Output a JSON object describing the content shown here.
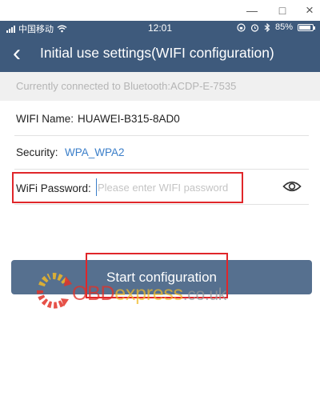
{
  "window": {
    "minimize_glyph": "—",
    "maximize_glyph": "□",
    "close_glyph": "×"
  },
  "status_bar": {
    "carrier": "中国移动",
    "time": "12:01",
    "battery_text": "85%",
    "battery_level": 0.85,
    "icons": [
      "signal-icon",
      "wifi-icon",
      "lock-rotation-icon",
      "alarm-icon",
      "bluetooth-icon",
      "battery-icon"
    ]
  },
  "nav": {
    "back_glyph": "‹",
    "title": "Initial use settings(WIFI configuration)"
  },
  "info": {
    "connected_text": "Currently connected to Bluetooth:ACDP-E-7535"
  },
  "form": {
    "wifi_name_label": "WIFI Name:",
    "wifi_name_value": "HUAWEI-B315-8AD0",
    "security_label": "Security:",
    "security_value": "WPA_WPA2",
    "password_label": "WiFi Password:",
    "password_placeholder": "Please enter WIFI password",
    "password_value": ""
  },
  "actions": {
    "start_label": "Start configuration"
  },
  "watermark": {
    "part_obd": "OBD",
    "part_express": "express",
    "part_tld": ".co.uk"
  },
  "colors": {
    "header": "#3e5a7c",
    "button": "#56708f",
    "link": "#3a7ec9",
    "annotation": "#e0262a"
  }
}
